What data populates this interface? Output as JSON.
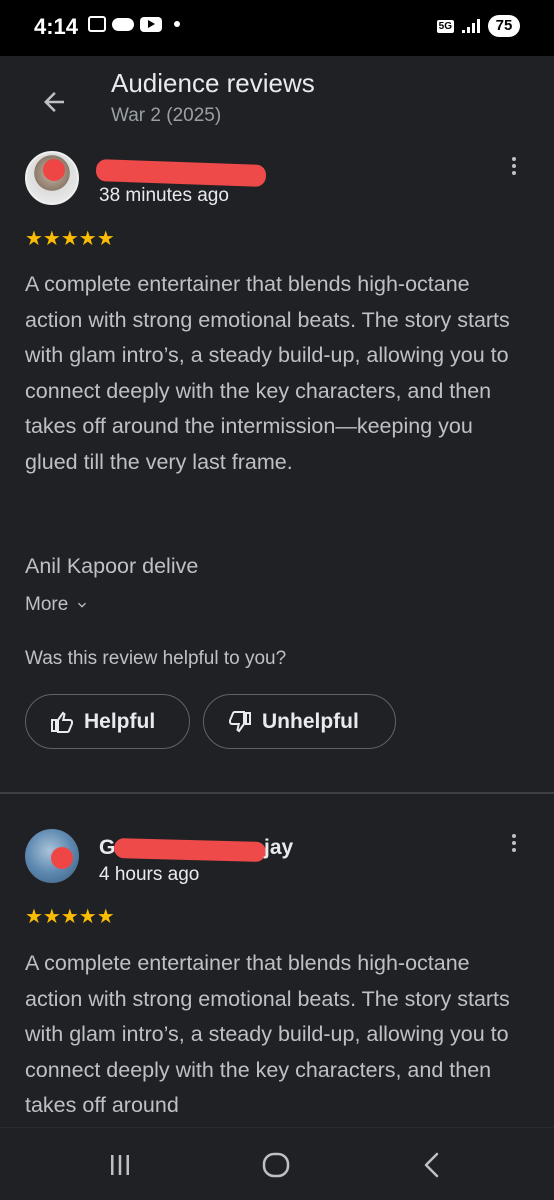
{
  "status_bar": {
    "time": "4:14",
    "network": "5G",
    "battery": "75",
    "icons": [
      "screenshot-icon",
      "cloud-icon",
      "youtube-icon",
      "notification-dot-icon",
      "signal-icon",
      "battery-icon"
    ]
  },
  "header": {
    "title": "Audience reviews",
    "subtitle": "War 2 (2025)",
    "back_icon": "arrow-left-icon"
  },
  "reviews": [
    {
      "author_visible": "",
      "time": "38 minutes ago",
      "stars": "★★★★★",
      "rating": 5,
      "body": "A complete entertainer that blends high-octane action with strong emotional beats. The story starts with glam intro’s, a steady build-up, allowing you to connect deeply with the key characters, and then takes off around the intermission—keeping you glued till the very last frame.",
      "extra": "Anil Kapoor delive",
      "more_label": "More",
      "helpful_question": "Was this review helpful to you?",
      "helpful_label": "Helpful",
      "unhelpful_label": "Unhelpful"
    },
    {
      "author_prefix": "G",
      "author_suffix": "jay",
      "time": "4 hours ago",
      "stars": "★★★★★",
      "rating": 5,
      "body": "A complete entertainer that blends high-octane action with strong emotional beats. The story starts with glam intro’s, a steady build-up, allowing you to connect deeply with the key characters, and then takes off around"
    }
  ],
  "colors": {
    "background": "#202124",
    "star": "#fbbc04",
    "redaction": "#ee4a4a"
  },
  "nav_bar": {
    "icons": [
      "recents-icon",
      "home-icon",
      "back-icon"
    ]
  }
}
